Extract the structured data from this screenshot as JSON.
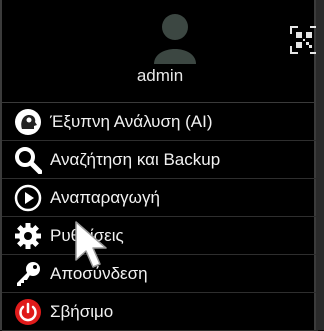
{
  "user": {
    "name": "admin"
  },
  "header": {
    "avatar_icon": "user-avatar-icon",
    "qr_icon": "qr-code-icon"
  },
  "menu": {
    "items": [
      {
        "label": "Έξυπνη Ανάλυση (AI)",
        "icon": "ai-head-icon"
      },
      {
        "label": "Αναζήτηση και Backup",
        "icon": "search-icon"
      },
      {
        "label": "Αναπαραγωγή",
        "icon": "play-icon"
      },
      {
        "label": "Ρυθμίσεις",
        "icon": "gear-icon"
      },
      {
        "label": "Αποσύνδεση",
        "icon": "key-icon"
      },
      {
        "label": "Σβήσιμο",
        "icon": "power-icon"
      }
    ]
  },
  "colors": {
    "background": "#000000",
    "text": "#f2f2f2",
    "power_red": "#e01b1b",
    "avatar": "#3c4742"
  }
}
